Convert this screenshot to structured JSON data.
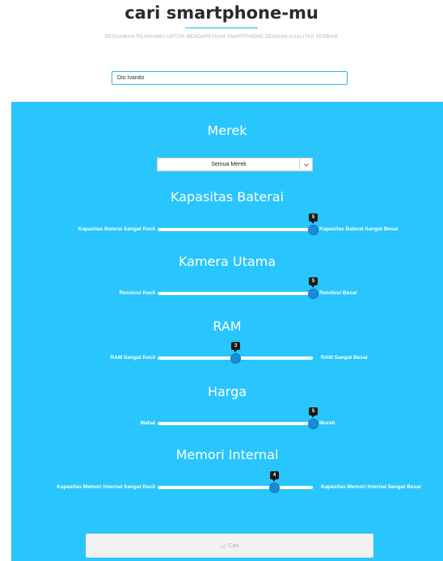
{
  "header": {
    "title": "cari smartphone-mu",
    "subtitle": "SESUAIKAN PILIHANMU UNTUK MENDAPATKAN SMARTPHONE DENGAN KUALITAS TERBAIK"
  },
  "name_input": {
    "value": "Dio Ivando"
  },
  "brand": {
    "title": "Merek",
    "selected": "Semua Merek"
  },
  "sliders": [
    {
      "title": "Kapasitas Baterai",
      "left": "Kapasitas Baterai Sangat Kecil",
      "right": "Kapasitas Baterai Sangat Besar",
      "value": "5",
      "fraction": 1.0
    },
    {
      "title": "Kamera Utama",
      "left": "Resolusi Kecil",
      "right": "Resolusi Besar",
      "value": "5",
      "fraction": 1.0
    },
    {
      "title": "RAM",
      "left": "RAM Sangat Kecil",
      "right": "RAM Sangat Besar",
      "value": "3",
      "fraction": 0.5
    },
    {
      "title": "Harga",
      "left": "Mahal",
      "right": "Murah",
      "value": "5",
      "fraction": 1.0
    },
    {
      "title": "Memori Internal",
      "left": "Kapasitas Memori Internal Sangat Kecil",
      "right": "Kapasitas Memori Internal Sangat Besar",
      "value": "4",
      "fraction": 0.75
    }
  ],
  "search_button": {
    "icon": "thumbs-up-icon",
    "label": "Cari"
  },
  "colors": {
    "panel": "#29c5fd",
    "accent": "#29b6f6",
    "thumb": "#1a8bd6",
    "tooltip": "#1b1b1b"
  }
}
